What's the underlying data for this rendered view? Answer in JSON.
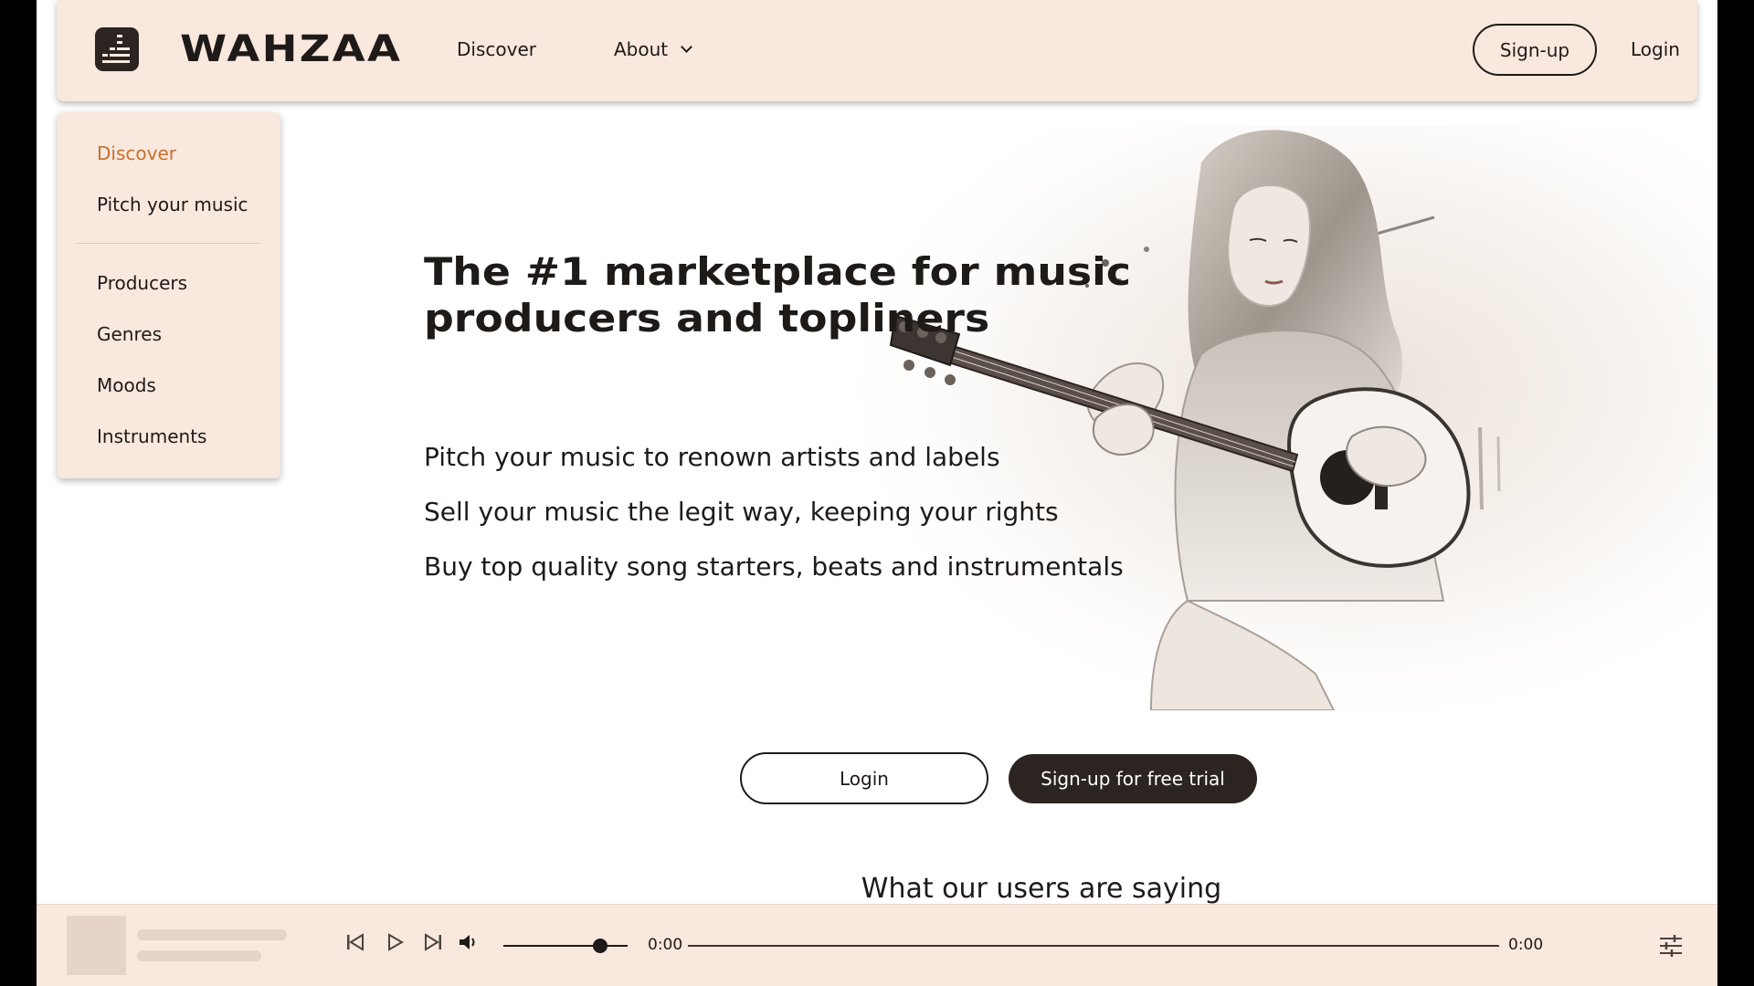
{
  "brand": {
    "name": "WAHZAA"
  },
  "nav": {
    "discover": "Discover",
    "about": "About",
    "signup": "Sign-up",
    "login": "Login"
  },
  "menu": {
    "items": [
      {
        "label": "Discover",
        "active": true
      },
      {
        "label": "Pitch your music"
      },
      {
        "label": "Producers"
      },
      {
        "label": "Genres"
      },
      {
        "label": "Moods"
      },
      {
        "label": "Instruments"
      }
    ]
  },
  "hero": {
    "title": "The #1 marketplace for music producers and topliners",
    "lines": [
      "Pitch your music to renown artists and labels",
      "Sell your music the legit way, keeping your rights",
      "Buy top quality song starters, beats and instrumentals"
    ],
    "login": "Login",
    "signup": "Sign-up for free trial"
  },
  "testimonials": {
    "heading": "What our users are saying"
  },
  "player": {
    "current_time": "0:00",
    "duration": "0:00",
    "volume_fraction": 0.78,
    "icons": [
      "skip-back-icon",
      "play-icon",
      "skip-forward-icon",
      "volume-icon",
      "equalizer-settings-icon"
    ]
  },
  "colors": {
    "accent": "#c7702e",
    "panel": "#f9e8de",
    "dark": "#2b2421"
  }
}
